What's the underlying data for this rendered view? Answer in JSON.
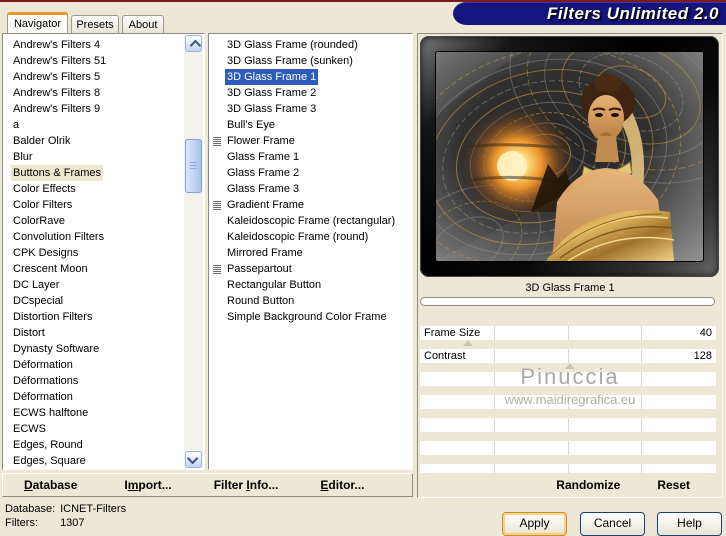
{
  "window": {
    "title": "Filters Unlimited 2.0"
  },
  "colors": {
    "bg": "#ECE8D5",
    "banner": "#15157E",
    "topline": "#7A1A1A",
    "selcat": "#ECE7CF",
    "selfil": "#2D5BBA"
  },
  "tabs": [
    {
      "label": "Navigator",
      "active": true
    },
    {
      "label": "Presets",
      "active": false
    },
    {
      "label": "About",
      "active": false
    }
  ],
  "category_list": {
    "selected": "Buttons & Frames",
    "items": [
      "Andrew's Filters 4",
      "Andrew's Filters 51",
      "Andrew's Filters 5",
      "Andrew's Filters 8",
      "Andrew's Filters 9",
      "a",
      "Balder Olrik",
      "Blur",
      "Buttons & Frames",
      "Color Effects",
      "Color Filters",
      "ColorRave",
      "Convolution Filters",
      "CPK Designs",
      "Crescent Moon",
      "DC Layer",
      "DCspecial",
      "Distortion Filters",
      "Distort",
      "Dynasty Software",
      "Déformation",
      "Déformations",
      "Déformation",
      "ECWS halftone",
      "ECWS",
      "Edges, Round",
      "Edges, Square"
    ]
  },
  "filter_list": {
    "selected": "3D Glass Frame 1",
    "items": [
      {
        "label": "3D Glass Frame (rounded)",
        "icon": false
      },
      {
        "label": "3D Glass Frame (sunken)",
        "icon": false
      },
      {
        "label": "3D Glass Frame 1",
        "icon": false,
        "selected": true
      },
      {
        "label": "3D Glass Frame 2",
        "icon": false
      },
      {
        "label": "3D Glass Frame 3",
        "icon": false
      },
      {
        "label": "Bull's Eye",
        "icon": false
      },
      {
        "label": "Flower Frame",
        "icon": true
      },
      {
        "label": "Glass Frame 1",
        "icon": false
      },
      {
        "label": "Glass Frame 2",
        "icon": false
      },
      {
        "label": "Glass Frame 3",
        "icon": false
      },
      {
        "label": "Gradient Frame",
        "icon": true
      },
      {
        "label": "Kaleidoscopic Frame (rectangular)",
        "icon": false
      },
      {
        "label": "Kaleidoscopic Frame (round)",
        "icon": false
      },
      {
        "label": "Mirrored Frame",
        "icon": false
      },
      {
        "label": "Passepartout",
        "icon": true
      },
      {
        "label": "Rectangular Button",
        "icon": false
      },
      {
        "label": "Round Button",
        "icon": false
      },
      {
        "label": "Simple Background Color Frame",
        "icon": false
      }
    ]
  },
  "preview": {
    "caption": "3D Glass Frame 1"
  },
  "sliders": [
    {
      "label": "Frame Size",
      "value": "40",
      "thumb_percent": 16
    },
    {
      "label": "Contrast",
      "value": "128",
      "thumb_percent": 50
    },
    {},
    {},
    {},
    {},
    {}
  ],
  "watermark": {
    "line1": "Pinuccia",
    "line2": "www.maidiregrafica.eu"
  },
  "panel_actions": {
    "randomize": "Randomize",
    "reset": "Reset"
  },
  "toolbar": {
    "items": [
      {
        "pre": "",
        "u": "D",
        "post": "atabase"
      },
      {
        "pre": "I",
        "u": "m",
        "post": "port..."
      },
      {
        "pre": "Filter ",
        "u": "I",
        "post": "nfo..."
      },
      {
        "pre": "",
        "u": "E",
        "post": "ditor..."
      }
    ]
  },
  "status": {
    "database_label": "Database:",
    "database_value": "ICNET-Filters",
    "filters_label": "Filters:",
    "filters_value": "1307"
  },
  "buttons": [
    {
      "label": "Apply",
      "default": true
    },
    {
      "label": "Cancel",
      "default": false
    },
    {
      "label": "Help",
      "default": false
    }
  ]
}
